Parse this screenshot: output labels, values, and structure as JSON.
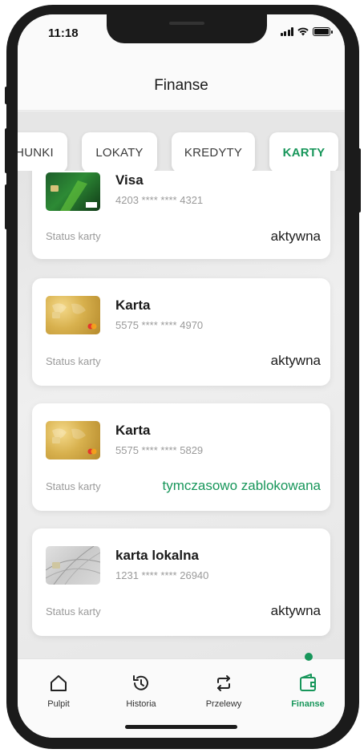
{
  "status": {
    "time": "11:18"
  },
  "header": {
    "title": "Finanse"
  },
  "tabs": [
    {
      "label": "HUNKI"
    },
    {
      "label": "LOKATY"
    },
    {
      "label": "KREDYTY"
    },
    {
      "label": "KARTY",
      "active": true
    }
  ],
  "cards": [
    {
      "name": "Visa",
      "number": "4203 **** **** 4321",
      "status_label": "Status karty",
      "status": "aktywna",
      "image": "visa-card"
    },
    {
      "name": "Karta",
      "number": "5575 **** **** 4970",
      "status_label": "Status karty",
      "status": "aktywna",
      "image": "gold-card"
    },
    {
      "name": "Karta",
      "number": "5575 **** **** 5829",
      "status_label": "Status karty",
      "status": "tymczasowo zablokowana",
      "image": "gold-card"
    },
    {
      "name": "karta lokalna",
      "number": "1231 **** **** 26940",
      "status_label": "Status karty",
      "status": "aktywna",
      "image": "local-card"
    }
  ],
  "nav": [
    {
      "label": "Pulpit",
      "icon": "home-icon"
    },
    {
      "label": "Historia",
      "icon": "history-icon"
    },
    {
      "label": "Przelewy",
      "icon": "transfer-icon"
    },
    {
      "label": "Finanse",
      "icon": "wallet-icon",
      "active": true
    }
  ],
  "colors": {
    "accent": "#17965a",
    "text": "#1a1a1a",
    "muted": "#9a9a9a"
  }
}
